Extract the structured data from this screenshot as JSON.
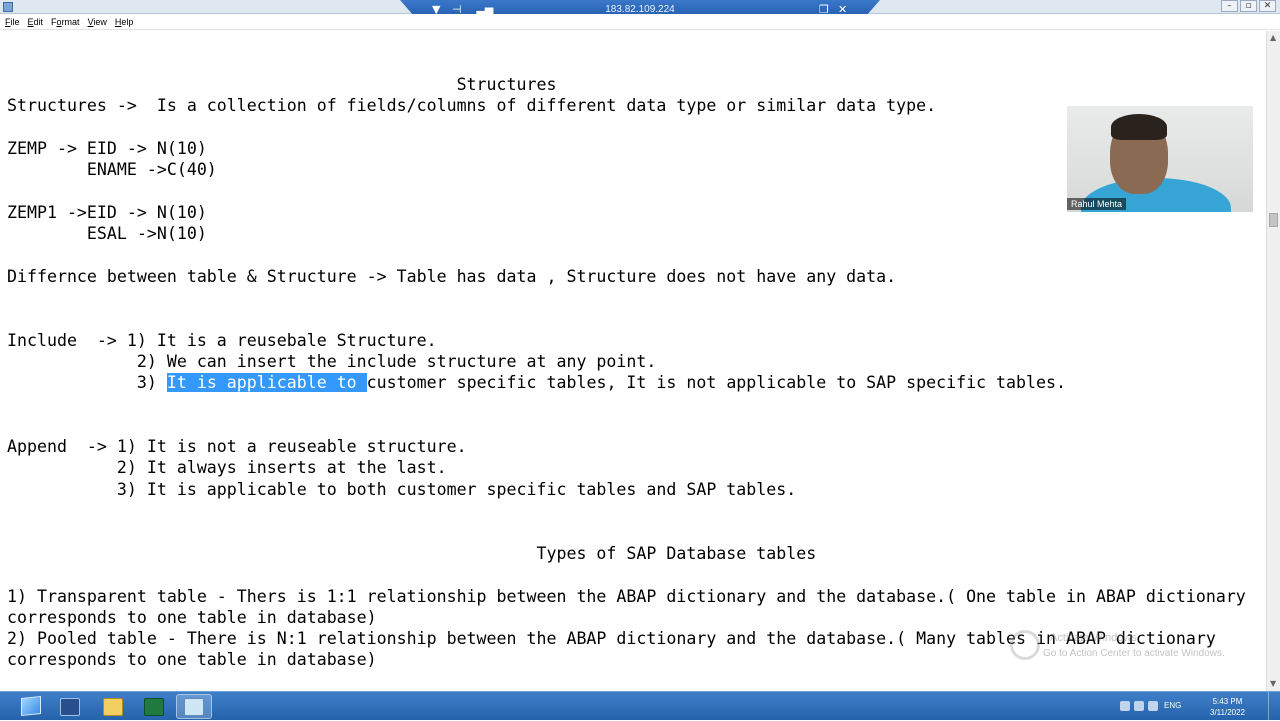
{
  "rdp_bar": {
    "address": "183.82.109.224",
    "pin_icon": "pin-icon",
    "signal_icon": "signal-bars-icon",
    "minimize_icon": "minimize-icon",
    "restore_icon": "restore-icon",
    "close_icon": "close-icon"
  },
  "window_controls": {
    "minimize": "–",
    "restore": "▫",
    "close": "✕"
  },
  "menu": {
    "file_first": "F",
    "file_rest": "ile",
    "edit_first": "E",
    "edit_rest": "dit",
    "format_pre": "F",
    "format_ul": "o",
    "format_rest": "rmat",
    "view_first": "V",
    "view_rest": "iew",
    "help_first": "H",
    "help_rest": "elp"
  },
  "document": {
    "l1": "                                             Structures",
    "l2": "Structures ->  Is a collection of fields/columns of different data type or similar data type.",
    "l3": "ZEMP -> EID -> N(10)",
    "l4": "        ENAME ->C(40)",
    "l5": "ZEMP1 ->EID -> N(10)",
    "l6": "        ESAL ->N(10)",
    "l7": "Differnce between table & Structure -> Table has data , Structure does not have any data.",
    "l8": "Include  -> 1) It is a reusebale Structure.",
    "l9": "             2) We can insert the include structure at any point.",
    "l10_pre": "             3) ",
    "l10_sel": "It is applicable to ",
    "l10_post": "customer specific tables, It is not applicable to SAP specific tables.",
    "l11": "Append  -> 1) It is not a reuseable structure.",
    "l12": "           2) It always inserts at the last.",
    "l13": "           3) It is applicable to both customer specific tables and SAP tables.",
    "l14": "                                                     Types of SAP Database tables",
    "l15": "1) Transparent table - Thers is 1:1 relationship between the ABAP dictionary and the database.( One table in ABAP dictionary",
    "l16": "corresponds to one table in database)",
    "l17": "2) Pooled table - There is N:1 relationship between the ABAP dictionary and the database.( Many tables in ABAP dictionary",
    "l18": "corresponds to one table in database)"
  },
  "webcam": {
    "name": "Rahul Mehta"
  },
  "watermark": {
    "line1": "Activate Windows",
    "line2": "Go to Action Center to activate Windows."
  },
  "taskbar": {
    "start_icon": "windows-start-icon",
    "apps": [
      "powershell-icon",
      "file-explorer-icon",
      "excel-icon",
      "notepad-icon"
    ],
    "lang": "ENG",
    "time": "5:43 PM",
    "date": "3/11/2022"
  },
  "colors": {
    "selection": "#3399ff",
    "taskbar": "#2663ad",
    "rdp_bar": "#1d56a8"
  }
}
